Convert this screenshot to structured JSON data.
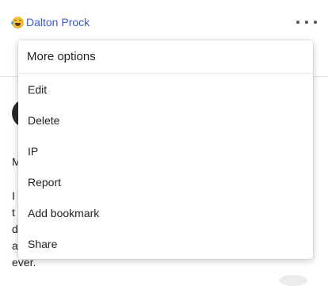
{
  "post": {
    "author": {
      "icon": "rofl-emoji-icon",
      "name": "Dalton Prock",
      "name_color": "#3d59c9"
    },
    "more_icon": "ellipsis-icon",
    "visible_fragments": [
      "M",
      "I",
      "t",
      "d",
      "a",
      "ever."
    ]
  },
  "menu": {
    "title": "More options",
    "items": [
      {
        "label": "Edit"
      },
      {
        "label": "Delete"
      },
      {
        "label": "IP"
      },
      {
        "label": "Report"
      },
      {
        "label": "Add bookmark"
      },
      {
        "label": "Share"
      }
    ]
  }
}
